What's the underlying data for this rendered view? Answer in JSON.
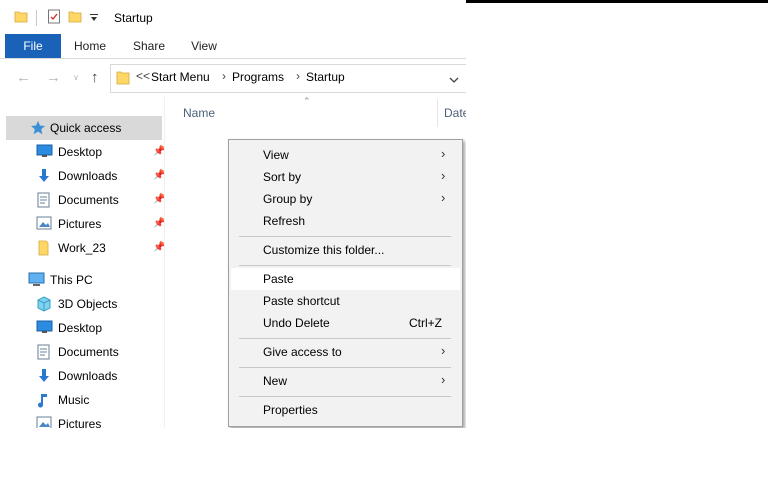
{
  "window": {
    "title": "Startup"
  },
  "ribbon": {
    "tabs": [
      "File",
      "Home",
      "Share",
      "View"
    ]
  },
  "address": {
    "overflow": "<<",
    "crumbs": [
      "Start Menu",
      "Programs",
      "Startup"
    ]
  },
  "nav": {
    "items": [
      {
        "label": "Quick access",
        "icon": "star-icon",
        "pinned": false,
        "selected": true
      },
      {
        "label": "Desktop",
        "icon": "desktop-icon",
        "pinned": true
      },
      {
        "label": "Downloads",
        "icon": "download-icon",
        "pinned": true
      },
      {
        "label": "Documents",
        "icon": "documents-icon",
        "pinned": true
      },
      {
        "label": "Pictures",
        "icon": "pictures-icon",
        "pinned": true
      },
      {
        "label": "Work_23",
        "icon": "folder-icon",
        "pinned": true
      },
      {
        "label": "This PC",
        "icon": "computer-icon",
        "pinned": false
      },
      {
        "label": "3D Objects",
        "icon": "cube-icon",
        "pinned": false
      },
      {
        "label": "Desktop",
        "icon": "desktop-icon",
        "pinned": false
      },
      {
        "label": "Documents",
        "icon": "documents-icon",
        "pinned": false
      },
      {
        "label": "Downloads",
        "icon": "download-icon",
        "pinned": false
      },
      {
        "label": "Music",
        "icon": "music-icon",
        "pinned": false
      },
      {
        "label": "Pictures",
        "icon": "pictures-icon",
        "pinned": false
      }
    ]
  },
  "content": {
    "columns": [
      "Name",
      "Date"
    ]
  },
  "context_menu": {
    "items": [
      {
        "label": "View",
        "submenu": true
      },
      {
        "label": "Sort by",
        "submenu": true
      },
      {
        "label": "Group by",
        "submenu": true
      },
      {
        "label": "Refresh"
      },
      {
        "label": "Customize this folder..."
      },
      {
        "label": "Paste",
        "hover": true
      },
      {
        "label": "Paste shortcut"
      },
      {
        "label": "Undo Delete",
        "shortcut": "Ctrl+Z"
      },
      {
        "label": "Give access to",
        "submenu": true
      },
      {
        "label": "New",
        "submenu": true
      },
      {
        "label": "Properties"
      }
    ]
  },
  "colors": {
    "accent": "#1a62b8",
    "folder": "#ffd766",
    "selection": "#d9d9d9"
  }
}
